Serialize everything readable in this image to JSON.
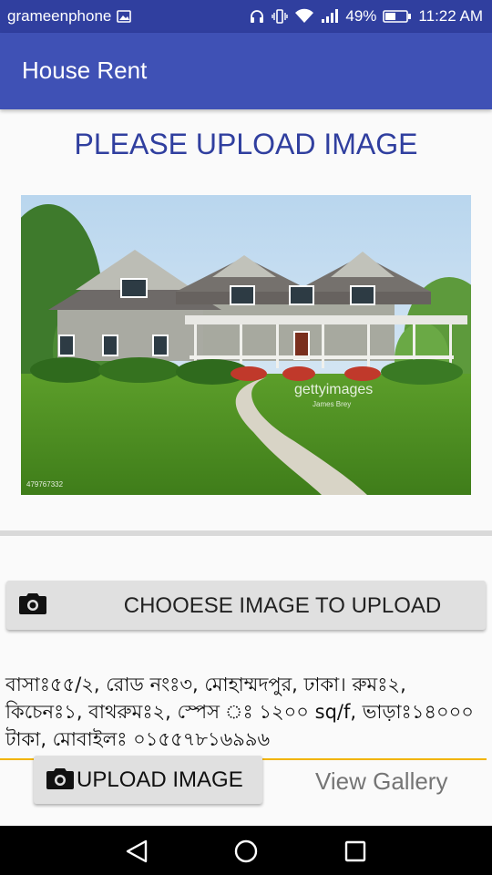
{
  "status_bar": {
    "carrier": "grameenphone",
    "battery": "49%",
    "time": "11:22 AM",
    "icons": [
      "image-notification-icon",
      "headphones-icon",
      "vibrate-icon",
      "wifi-icon",
      "signal-icon",
      "battery-icon"
    ]
  },
  "app_bar": {
    "title": "House Rent"
  },
  "main": {
    "heading": "PLEASE UPLOAD IMAGE",
    "image": {
      "description": "two-story house with lawn",
      "watermark": "gettyimages",
      "credit": "James Brey",
      "id_text": "479767332"
    },
    "choose_button": "CHOOESE IMAGE TO UPLOAD",
    "description_text": "বাসাঃ৫৫/২, রোড নংঃ৩, মোহাম্মদপুর,  ঢাকা। রুমঃ২, কিচেনঃ১, বাথরুমঃ২, স্পেস ঃ ১২০০ sq/f, ভাড়াঃ১৪০০০ টাকা, মোবাইলঃ ০১৫৫৭৮১৬৯৯৬",
    "upload_button": "UPLOAD IMAGE",
    "view_gallery": "View Gallery"
  },
  "colors": {
    "primary": "#3f51b5",
    "primary_dark": "#303f9f",
    "accent": "#f2b400"
  },
  "nav_bar": {
    "icons": [
      "back-icon",
      "home-icon",
      "recents-icon"
    ]
  }
}
